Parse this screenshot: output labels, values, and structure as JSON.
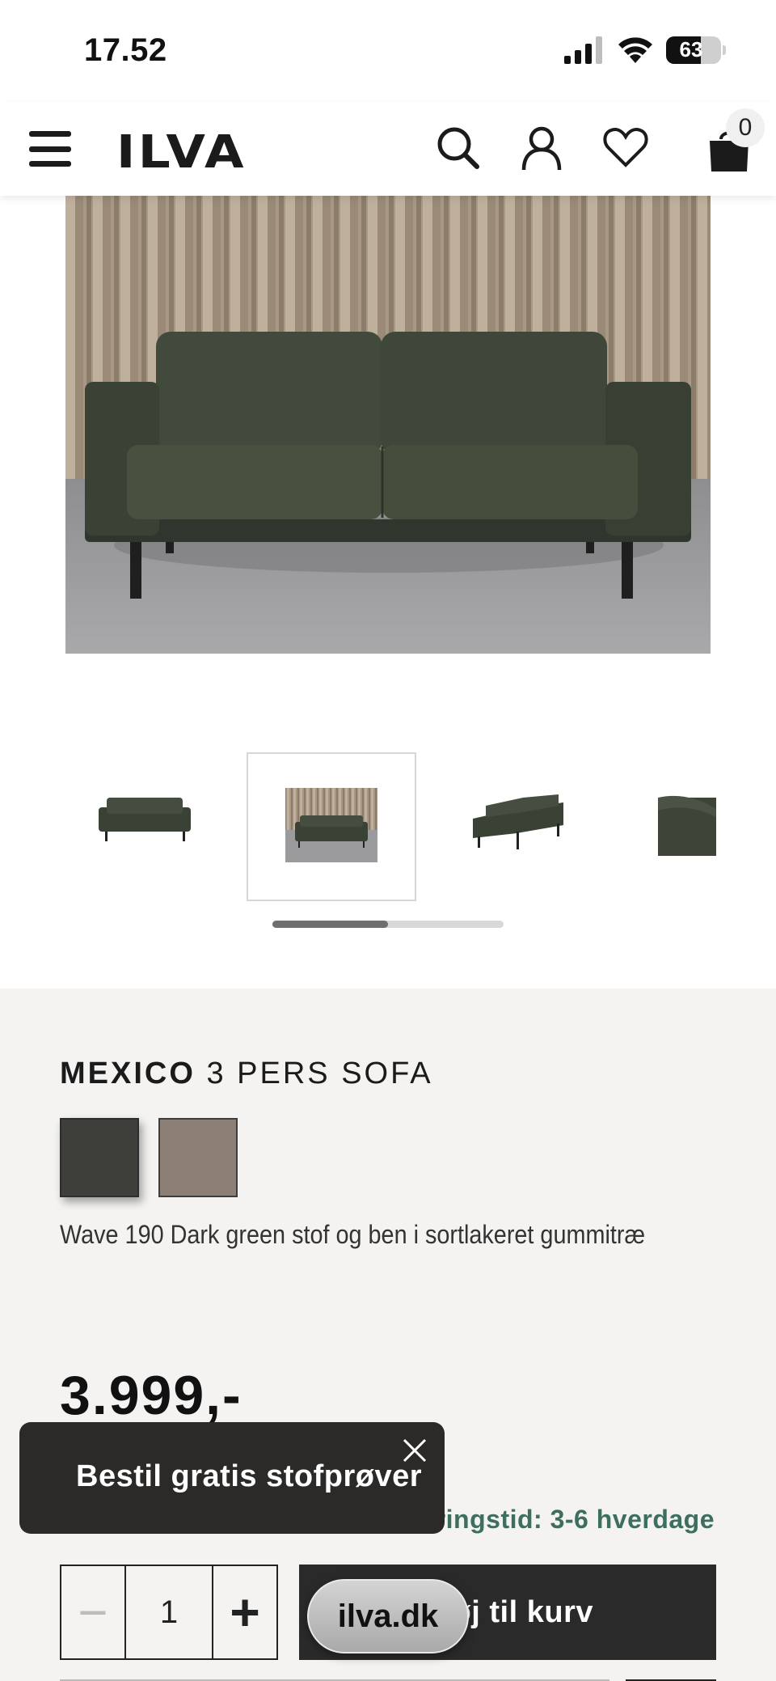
{
  "status_bar": {
    "time": "17.52",
    "battery": "63"
  },
  "header": {
    "logo": "ILVA",
    "cart_count": "0"
  },
  "gallery": {
    "thumbnail_count": 4,
    "active_thumbnail": 2
  },
  "product": {
    "title_bold": "MEXICO",
    "title_rest": " 3 PERS SOFA",
    "swatches": [
      {
        "color": "#3e3f3b",
        "selected": true
      },
      {
        "color": "#8b7f76",
        "selected": false
      }
    ],
    "variant_description": "Wave 190 Dark green stof og ben i sortlakeret gummitræ",
    "price": "3.999,-",
    "delivery_visible": "eringstid: 3-6 hverdage"
  },
  "purchase": {
    "minus": "−",
    "quantity": "1",
    "plus": "+",
    "add_to_cart_visible": "øj til kurv"
  },
  "toast": {
    "text": "Bestil gratis stofprøver"
  },
  "browser": {
    "url": "ilva.dk"
  },
  "colors": {
    "accent_green": "#3e6f5e",
    "dark_button": "#2a2a2a",
    "section_bg": "#f4f3f1"
  }
}
